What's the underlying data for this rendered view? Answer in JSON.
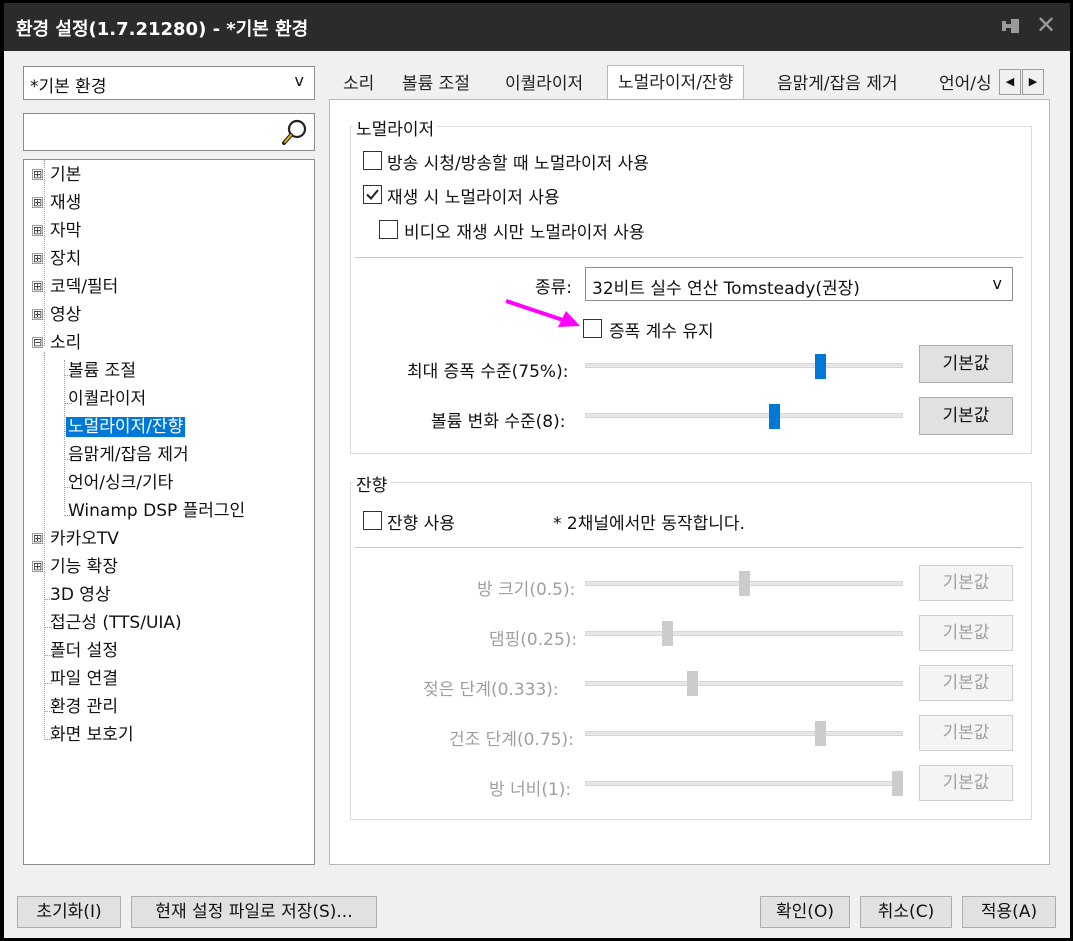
{
  "window": {
    "title": "환경 설정(1.7.21280) - *기본 환경"
  },
  "profile": {
    "selected": "*기본 환경"
  },
  "search": {
    "value": ""
  },
  "tree": {
    "items": [
      {
        "label": "기본",
        "expand": "⊞"
      },
      {
        "label": "재생",
        "expand": "⊞"
      },
      {
        "label": "자막",
        "expand": "⊞"
      },
      {
        "label": "장치",
        "expand": "⊞"
      },
      {
        "label": "코덱/필터",
        "expand": "⊞"
      },
      {
        "label": "영상",
        "expand": "⊞"
      },
      {
        "label": "소리",
        "expand": "⊟"
      },
      {
        "label": "볼륨 조절"
      },
      {
        "label": "이퀄라이저"
      },
      {
        "label": "노멀라이저/잔향"
      },
      {
        "label": "음맑게/잡음 제거"
      },
      {
        "label": "언어/싱크/기타"
      },
      {
        "label": "Winamp DSP 플러그인"
      },
      {
        "label": "카카오TV",
        "expand": "⊞"
      },
      {
        "label": "기능 확장",
        "expand": "⊞"
      },
      {
        "label": "3D 영상"
      },
      {
        "label": "접근성 (TTS/UIA)"
      },
      {
        "label": "폴더 설정"
      },
      {
        "label": "파일 연결"
      },
      {
        "label": "환경 관리"
      },
      {
        "label": "화면 보호기"
      }
    ]
  },
  "tabs": [
    "소리",
    "볼륨 조절",
    "이퀄라이저",
    "노멀라이저/잔향",
    "음맑게/잡음 제거",
    "언어/싱"
  ],
  "normalizer": {
    "group_title": "노멀라이저",
    "cb_broadcast": "방송 시청/방송할 때 노멀라이저 사용",
    "cb_broadcast_checked": false,
    "cb_play": "재생 시 노멀라이저 사용",
    "cb_play_checked": true,
    "cb_video_only": "비디오 재생 시만 노멀라이저 사용",
    "cb_video_only_checked": false,
    "type_label": "종류:",
    "type_value": "32비트 실수 연산 Tomsteady(권장)",
    "cb_keep_gain": "증폭 계수 유지",
    "cb_keep_gain_checked": false,
    "max_gain_label": "최대 증폭 수준(75%):",
    "max_gain_level": 0.75,
    "volume_change_label": "볼륨 변화 수준(8):",
    "volume_change_level": 0.6,
    "default_label": "기본값"
  },
  "reverb": {
    "group_title": "잔향",
    "cb_use": "잔향 사용",
    "cb_use_checked": false,
    "note": "* 2채널에서만 동작합니다.",
    "sliders": [
      {
        "label": "방 크기(0.5):",
        "level": 0.5
      },
      {
        "label": "댐핑(0.25):",
        "level": 0.25
      },
      {
        "label": "젖은 단계(0.333):",
        "level": 0.333
      },
      {
        "label": "건조 단계(0.75):",
        "level": 0.75
      },
      {
        "label": "방 너비(1):",
        "level": 1.0
      }
    ],
    "default_label": "기본값"
  },
  "footer": {
    "reset": "초기화(I)",
    "save_file": "현재 설정 파일로 저장(S)...",
    "ok": "확인(O)",
    "cancel": "취소(C)",
    "apply": "적용(A)"
  },
  "colors": {
    "accent": "#0078d7",
    "annotation_arrow": "#ff00ff",
    "titlebar": "#2b2b2b"
  }
}
